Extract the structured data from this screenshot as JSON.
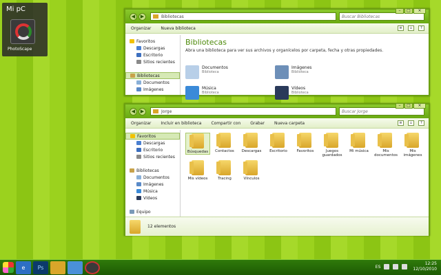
{
  "desktop": {
    "panel_title": "Mi pC",
    "icon_label": "PhotoScape"
  },
  "win1": {
    "address": "Bibliotecas",
    "search_placeholder": "Buscar Bibliotecas",
    "toolbar": [
      "Organizar",
      "Nueva biblioteca"
    ],
    "nav": [
      {
        "label": "Favoritos",
        "sub": false,
        "sel": false,
        "color": "#f2c200"
      },
      {
        "label": "Descargas",
        "sub": true,
        "sel": false,
        "color": "#4a7fd1"
      },
      {
        "label": "Escritorio",
        "sub": true,
        "sel": false,
        "color": "#3d6fbf"
      },
      {
        "label": "Sitios recientes",
        "sub": true,
        "sel": false,
        "color": "#8a8a8a"
      },
      {
        "label": "",
        "sub": false,
        "sel": false,
        "color": ""
      },
      {
        "label": "Bibliotecas",
        "sub": false,
        "sel": true,
        "color": "#c8a24a"
      },
      {
        "label": "Documentos",
        "sub": true,
        "sel": false,
        "color": "#8ab0d8"
      },
      {
        "label": "Imágenes",
        "sub": true,
        "sel": false,
        "color": "#5a8ac8"
      }
    ],
    "heading": "Bibliotecas",
    "subtitle": "Abra una biblioteca para ver sus archivos y organícelos por carpeta, fecha y otras propiedades.",
    "libraries": [
      {
        "name": "Documentos",
        "type": "Biblioteca",
        "color": "#b8cfe8"
      },
      {
        "name": "Imágenes",
        "type": "Biblioteca",
        "color": "#6d8fb8"
      },
      {
        "name": "Música",
        "type": "Biblioteca",
        "color": "#3b8ad8"
      },
      {
        "name": "Vídeos",
        "type": "Biblioteca",
        "color": "#2a3a5a"
      }
    ]
  },
  "win2": {
    "address": "Jorge",
    "search_placeholder": "Buscar Jorge",
    "toolbar": [
      "Organizar",
      "Incluir en biblioteca",
      "Compartir con",
      "Grabar",
      "Nueva carpeta"
    ],
    "nav": [
      {
        "label": "Favoritos",
        "sub": false,
        "sel": true,
        "color": "#f2c200"
      },
      {
        "label": "Descargas",
        "sub": true,
        "sel": false,
        "color": "#4a7fd1"
      },
      {
        "label": "Escritorio",
        "sub": true,
        "sel": false,
        "color": "#3d6fbf"
      },
      {
        "label": "Sitios recientes",
        "sub": true,
        "sel": false,
        "color": "#8a8a8a"
      },
      {
        "label": "",
        "sub": false,
        "sel": false,
        "color": ""
      },
      {
        "label": "Bibliotecas",
        "sub": false,
        "sel": false,
        "color": "#c8a24a"
      },
      {
        "label": "Documentos",
        "sub": true,
        "sel": false,
        "color": "#8ab0d8"
      },
      {
        "label": "Imágenes",
        "sub": true,
        "sel": false,
        "color": "#5a8ac8"
      },
      {
        "label": "Música",
        "sub": true,
        "sel": false,
        "color": "#3b8ad8"
      },
      {
        "label": "Vídeos",
        "sub": true,
        "sel": false,
        "color": "#2a3a5a"
      },
      {
        "label": "",
        "sub": false,
        "sel": false,
        "color": ""
      },
      {
        "label": "Equipo",
        "sub": false,
        "sel": false,
        "color": "#7a9ab8"
      }
    ],
    "folders_row1": [
      "Búsquedas",
      "Contactos",
      "Descargas",
      "Escritorio",
      "Favoritos",
      "Juegos guardados",
      "Mi música",
      "Mis documentos",
      "Mis imágenes"
    ],
    "folders_row2": [
      "Mis vídeos",
      "Tracing",
      "Vínculos"
    ],
    "status": "12 elementos"
  },
  "taskbar": {
    "language": "ES",
    "time": "12:25",
    "date": "12/10/2010",
    "apps": [
      "start-orb",
      "internet-explorer",
      "photoshop",
      "file-explorer",
      "control-panel",
      "photoscape"
    ]
  }
}
